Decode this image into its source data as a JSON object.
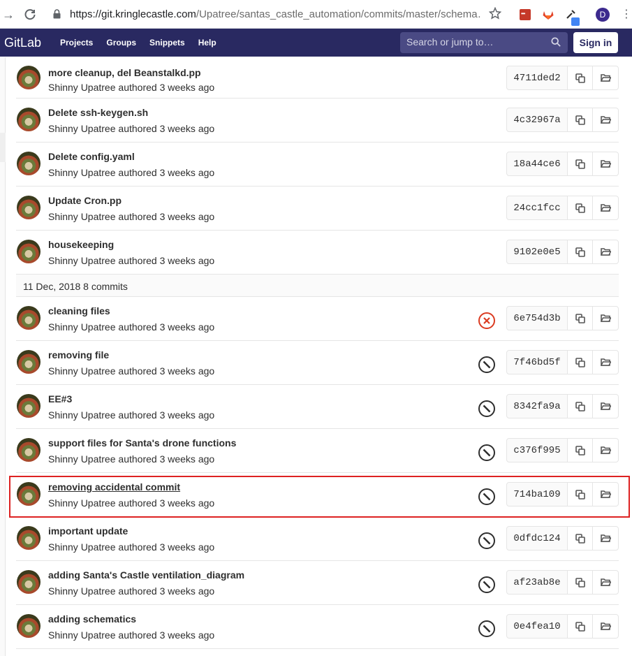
{
  "browser": {
    "url_host": "https://git.kringlecastle.com",
    "url_path": "/Upatree/santas_castle_automation/commits/master/schema…",
    "profile_initial": "D"
  },
  "navbar": {
    "logo": "GitLab",
    "links": [
      "Projects",
      "Groups",
      "Snippets",
      "Help"
    ],
    "search_placeholder": "Search or jump to…",
    "sign_in": "Sign in"
  },
  "commits_before": [
    {
      "title": "more cleanup, del Beanstalkd.pp",
      "author": "Shinny Upatree",
      "authored": "authored 3 weeks ago",
      "sha": "4711ded2"
    },
    {
      "title": "Delete ssh-keygen.sh",
      "author": "Shinny Upatree",
      "authored": "authored 3 weeks ago",
      "sha": "4c32967a"
    },
    {
      "title": "Delete config.yaml",
      "author": "Shinny Upatree",
      "authored": "authored 3 weeks ago",
      "sha": "18a44ce6"
    },
    {
      "title": "Update Cron.pp",
      "author": "Shinny Upatree",
      "authored": "authored 3 weeks ago",
      "sha": "24cc1fcc"
    },
    {
      "title": "housekeeping",
      "author": "Shinny Upatree",
      "authored": "authored 3 weeks ago",
      "sha": "9102e0e5"
    }
  ],
  "day_header": {
    "date": "11 Dec, 2018",
    "count": "8 commits"
  },
  "commits_day": [
    {
      "title": "cleaning files",
      "author": "Shinny Upatree",
      "authored": "authored 3 weeks ago",
      "sha": "6e754d3b",
      "status": "failed"
    },
    {
      "title": "removing file",
      "author": "Shinny Upatree",
      "authored": "authored 3 weeks ago",
      "sha": "7f46bd5f",
      "status": "skipped"
    },
    {
      "title": "EE#3",
      "author": "Shinny Upatree",
      "authored": "authored 3 weeks ago",
      "sha": "8342fa9a",
      "status": "skipped"
    },
    {
      "title": "support files for Santa's drone functions",
      "author": "Shinny Upatree",
      "authored": "authored 3 weeks ago",
      "sha": "c376f995",
      "status": "skipped"
    },
    {
      "title": "removing accidental commit",
      "author": "Shinny Upatree",
      "authored": "authored 3 weeks ago",
      "sha": "714ba109",
      "status": "skipped"
    },
    {
      "title": "important update",
      "author": "Shinny Upatree",
      "authored": "authored 3 weeks ago",
      "sha": "0dfdc124",
      "status": "skipped"
    },
    {
      "title": "adding Santa's Castle ventilation_diagram",
      "author": "Shinny Upatree",
      "authored": "authored 3 weeks ago",
      "sha": "af23ab8e",
      "status": "skipped"
    },
    {
      "title": "adding schematics",
      "author": "Shinny Upatree",
      "authored": "authored 3 weeks ago",
      "sha": "0e4fea10",
      "status": "skipped"
    }
  ],
  "colors": {
    "navbar": "#292961",
    "failed": "#db3b21",
    "skipped": "#2e2e2e",
    "highlight": "#dd2222"
  }
}
